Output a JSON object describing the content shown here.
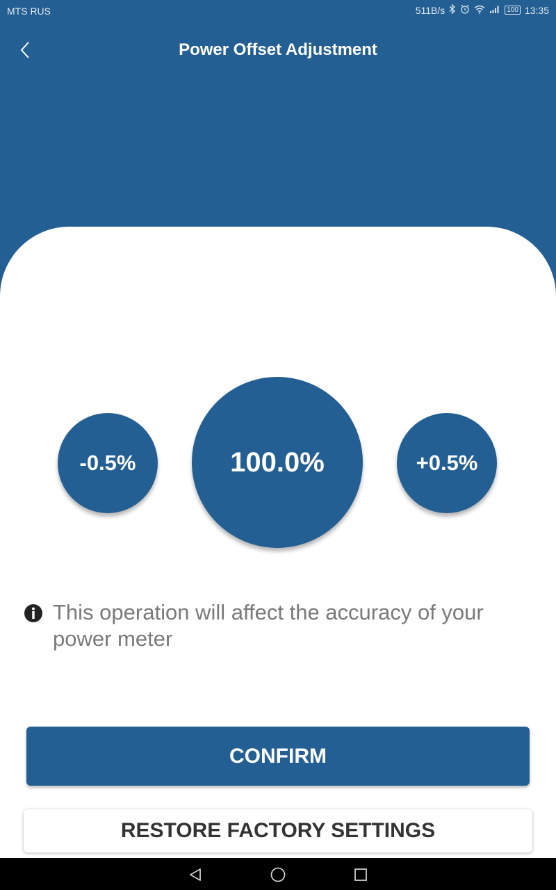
{
  "status_bar": {
    "carrier": "MTS RUS",
    "speed": "511B/s",
    "battery": "100",
    "time": "13:35"
  },
  "header": {
    "title": "Power Offset Adjustment",
    "back_icon": "chevron-left-icon"
  },
  "adjustment": {
    "decrease_label": "-0.5%",
    "value": "100.0%",
    "increase_label": "+0.5%"
  },
  "notice": {
    "icon": "info-icon",
    "text": "This operation will affect the accuracy of your power meter"
  },
  "buttons": {
    "confirm": "CONFIRM",
    "restore": "RESTORE FACTORY SETTINGS"
  },
  "colors": {
    "primary": "#235f92",
    "card": "#ffffff",
    "notice_text": "#7a7a7a",
    "restore_text": "#333333"
  },
  "nav_bar": {
    "icons": [
      "back-triangle-icon",
      "home-circle-icon",
      "recents-square-icon"
    ]
  }
}
